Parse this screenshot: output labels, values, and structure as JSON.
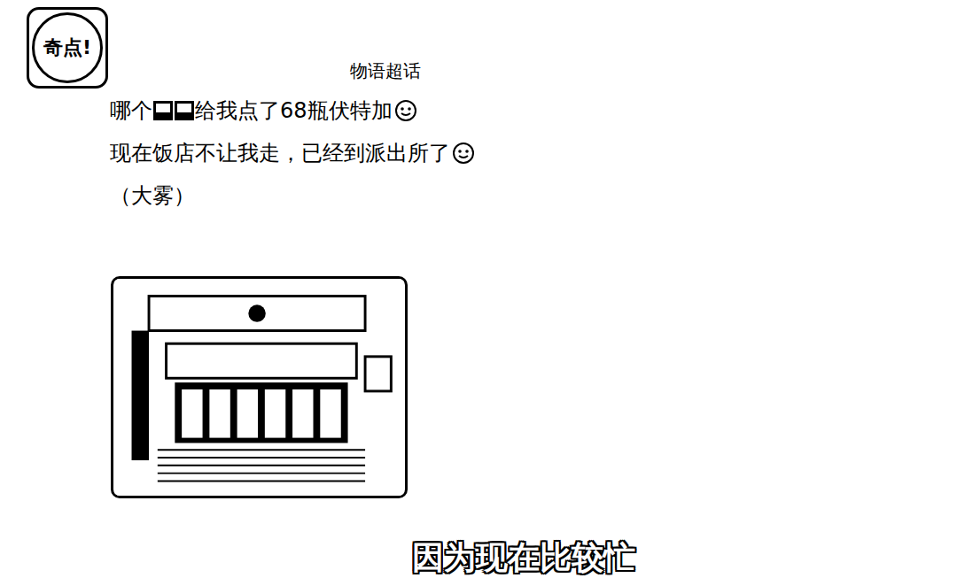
{
  "logo": {
    "text": "奇点!"
  },
  "post": {
    "topic": "物语超话",
    "lines": [
      {
        "parts": [
          {
            "kind": "text",
            "text": "哪个"
          },
          {
            "kind": "redaction"
          },
          {
            "kind": "redaction"
          },
          {
            "kind": "text",
            "text": "给我点了68瓶伏特加"
          },
          {
            "kind": "emoji"
          }
        ]
      },
      {
        "parts": [
          {
            "kind": "text",
            "text": "现在饭店不让我走，已经到派出所了"
          },
          {
            "kind": "emoji"
          }
        ]
      },
      {
        "parts": [
          {
            "kind": "text",
            "text": "（大雾）"
          }
        ]
      }
    ]
  },
  "caption": "因为现在比较忙"
}
